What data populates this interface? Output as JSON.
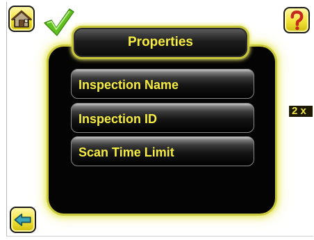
{
  "panel": {
    "title": "Properties",
    "menu_items": [
      {
        "label": "Inspection Name"
      },
      {
        "label": "Inspection ID"
      },
      {
        "label": "Scan Time Limit"
      }
    ]
  },
  "status": {
    "zoom_label": "2 x"
  },
  "icons": {
    "home": "home-icon",
    "check": "checkmark-icon",
    "help": "question-mark-icon",
    "back": "back-arrow-icon"
  },
  "colors": {
    "label_yellow": "#f6ec42",
    "button_yellow": "#f3e238",
    "glow": "#e9ea6a",
    "check_green": "#5fbf1f",
    "help_red": "#c62a1f",
    "back_teal": "#3aa6b8"
  }
}
